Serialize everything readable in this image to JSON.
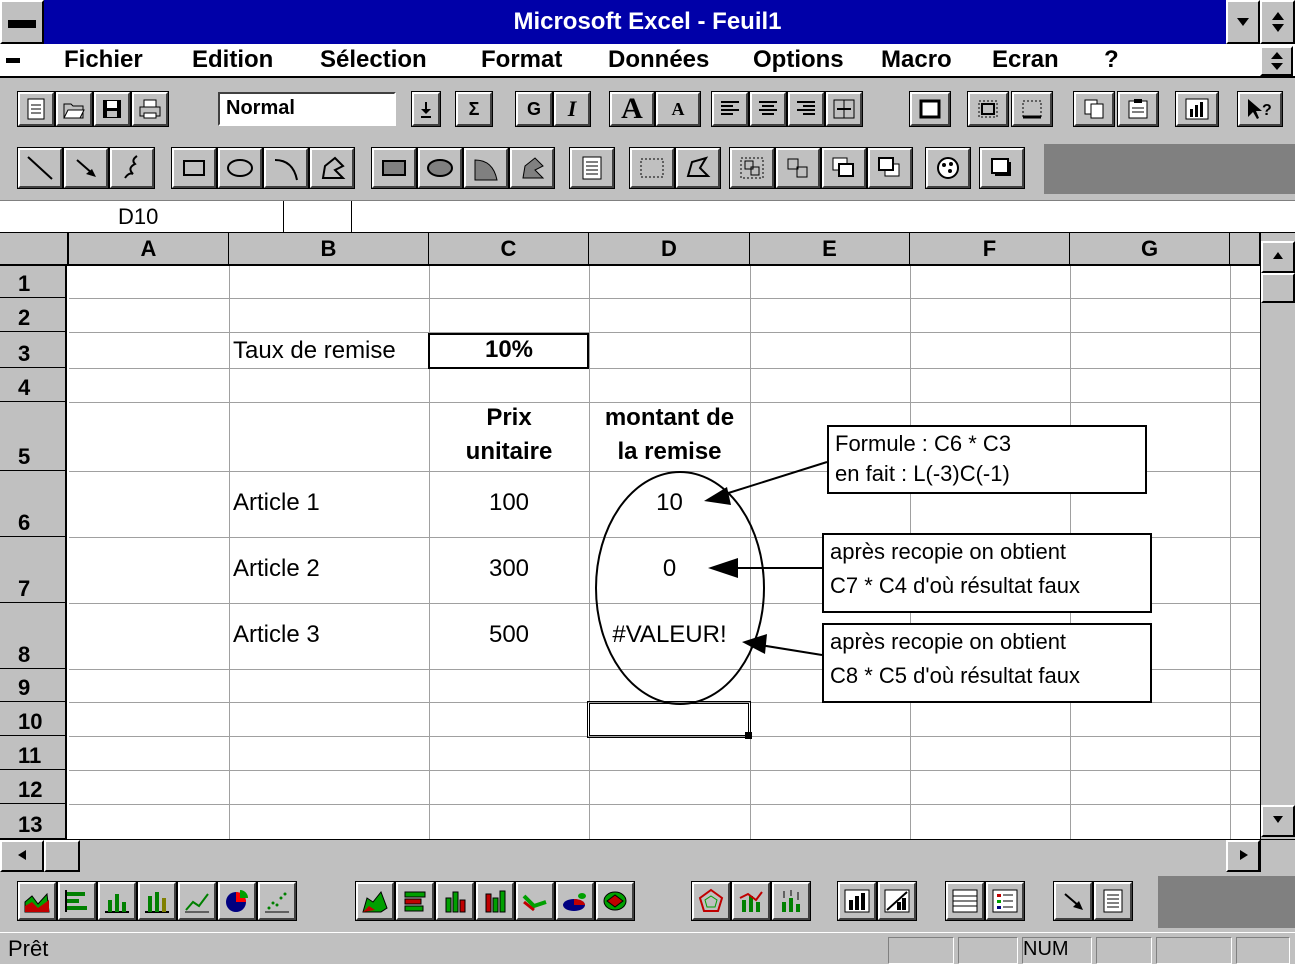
{
  "window": {
    "title": "Microsoft Excel - Feuil1",
    "control_menu_icon": "dash-icon",
    "min_icon": "triangle-down-icon",
    "restore_icon": "updown-arrows-icon"
  },
  "menu": {
    "items": [
      "Fichier",
      "Edition",
      "Sélection",
      "Format",
      "Données",
      "Options",
      "Macro",
      "Ecran",
      "?"
    ]
  },
  "toolbar": {
    "style_value": "Normal",
    "sum_label": "Σ",
    "bold_label": "G",
    "italic_label": "I",
    "font_up_label": "A",
    "font_down_label": "A"
  },
  "formula_bar": {
    "cell_ref": "D10",
    "content": ""
  },
  "sheet": {
    "columns": [
      "A",
      "B",
      "C",
      "D",
      "E",
      "F",
      "G"
    ],
    "rows": [
      "1",
      "2",
      "3",
      "4",
      "5",
      "6",
      "7",
      "8",
      "9",
      "10",
      "11",
      "12",
      "13"
    ],
    "cells": {
      "B3": "Taux de remise",
      "C3": "10%",
      "C5_line1": "Prix",
      "C5_line2": "unitaire",
      "D5_line1": "montant de",
      "D5_line2": "la remise",
      "B6": "Article 1",
      "C6": "100",
      "D6": "10",
      "B7": "Article 2",
      "C7": "300",
      "D7": "0",
      "B8": "Article 3",
      "C8": "500",
      "D8": "#VALEUR!"
    },
    "callouts": [
      {
        "line1": "Formule : C6 * C3",
        "line2": "en fait : L(-3)C(-1)"
      },
      {
        "line1": "après recopie on obtient",
        "line2": "C7 * C4  d'où résultat faux"
      },
      {
        "line1": "après recopie on obtient",
        "line2": "C8 * C5  d'où résultat faux"
      }
    ]
  },
  "status": {
    "text": "Prêt",
    "num_indicator": "NUM"
  },
  "colors": {
    "title_bar": "#0000a8",
    "chrome": "#c0c0c0",
    "grid": "#a0a0a0"
  }
}
